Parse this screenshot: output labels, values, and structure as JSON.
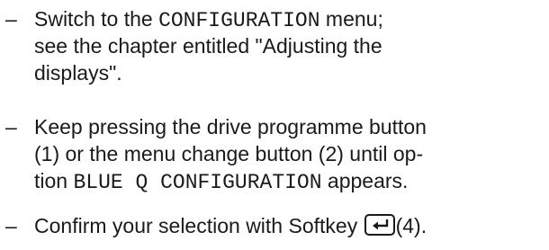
{
  "bullet_glyph": "–",
  "items": [
    {
      "line1_pre": "Switch to the ",
      "line1_code": "CONFIGURATION",
      "line1_post": " menu;",
      "line2": "see the chapter entitled \"Adjusting the",
      "line3": "displays\"."
    },
    {
      "line1": "Keep pressing the drive programme button",
      "line2": "(1) or the menu change button (2) until op-",
      "line3_pre": "tion ",
      "line3_code": "BLUE Q CONFIGURATION",
      "line3_post": " appears."
    },
    {
      "line1_pre": "Confirm your selection with Softkey ",
      "key_icon": "enter-return-icon",
      "line1_post": "(4)."
    }
  ]
}
